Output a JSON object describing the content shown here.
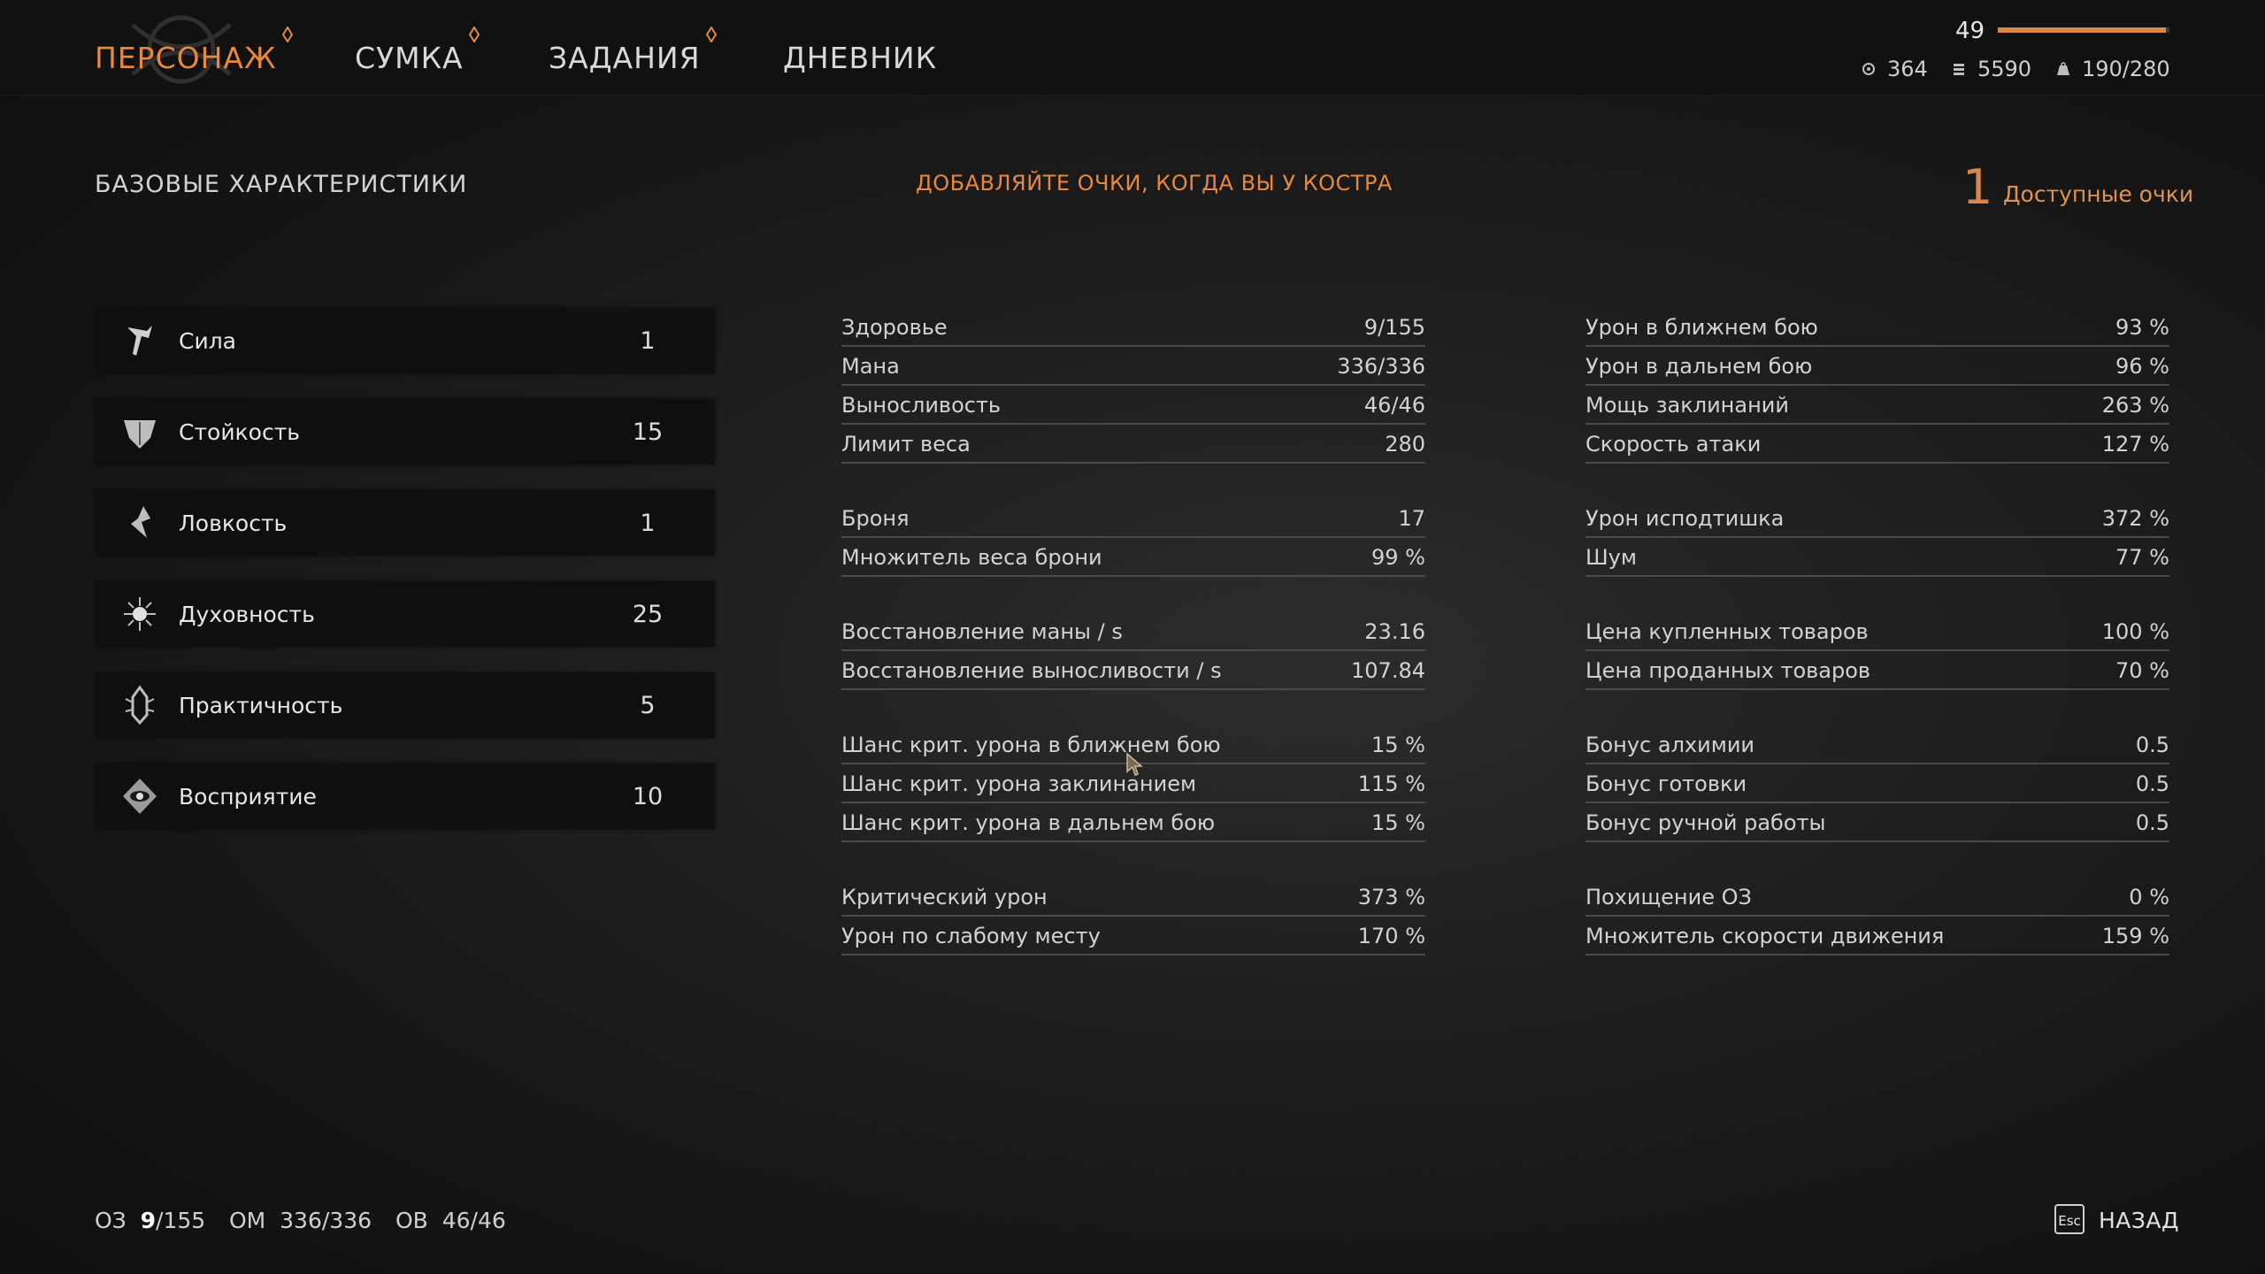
{
  "nav": {
    "tabs": [
      {
        "label": "ПЕРСОНАЖ",
        "active": true
      },
      {
        "label": "СУМКА",
        "active": false
      },
      {
        "label": "ЗАДАНИЯ",
        "active": false
      },
      {
        "label": "ДНЕВНИК",
        "active": false
      }
    ]
  },
  "player": {
    "level": "49",
    "xp_progress": 0.98,
    "resources": {
      "first": {
        "value": "364",
        "icon": "coin-icon"
      },
      "second": {
        "value": "5590",
        "icon": "coins-stack-icon"
      },
      "weight": {
        "value": "190/280",
        "icon": "weight-icon"
      }
    }
  },
  "base": {
    "title": "БАЗОВЫЕ ХАРАКТЕРИСТИКИ",
    "hint": "ДОБАВЛЯЙТЕ ОЧКИ, КОГДА ВЫ У КОСТРА",
    "available_points": "1",
    "available_label": "Доступные очки"
  },
  "attributes": [
    {
      "label": "Сила",
      "value": "1",
      "icon": "strength-icon"
    },
    {
      "label": "Стойкость",
      "value": "15",
      "icon": "endurance-icon"
    },
    {
      "label": "Ловкость",
      "value": "1",
      "icon": "dexterity-icon"
    },
    {
      "label": "Духовность",
      "value": "25",
      "icon": "spirit-icon"
    },
    {
      "label": "Практичность",
      "value": "5",
      "icon": "practicality-icon"
    },
    {
      "label": "Восприятие",
      "value": "10",
      "icon": "perception-icon"
    }
  ],
  "stats_left": [
    {
      "name": "Здоровье",
      "value": "9/155"
    },
    {
      "name": "Мана",
      "value": "336/336"
    },
    {
      "name": "Выносливость",
      "value": "46/46"
    },
    {
      "name": "Лимит веса",
      "value": "280"
    },
    {
      "name": "Броня",
      "value": "17"
    },
    {
      "name": "Множитель веса брони",
      "value": "99 %"
    },
    {
      "name": "Восстановление маны / s",
      "value": "23.16"
    },
    {
      "name": "Восстановление выносливости / s",
      "value": "107.84"
    },
    {
      "name": "Шанс крит. урона в ближнем бою",
      "value": "15 %"
    },
    {
      "name": "Шанс крит. урона заклинанием",
      "value": "115 %"
    },
    {
      "name": "Шанс крит. урона в дальнем бою",
      "value": "15 %"
    },
    {
      "name": "Критический урон",
      "value": "373 %"
    },
    {
      "name": "Урон по слабому месту",
      "value": "170 %"
    }
  ],
  "stats_right": [
    {
      "name": "Урон в ближнем бою",
      "value": "93 %"
    },
    {
      "name": "Урон в дальнем бою",
      "value": "96 %"
    },
    {
      "name": "Мощь заклинаний",
      "value": "263 %"
    },
    {
      "name": "Скорость атаки",
      "value": "127 %"
    },
    {
      "name": "Урон исподтишка",
      "value": "372 %"
    },
    {
      "name": "Шум",
      "value": "77 %"
    },
    {
      "name": "Цена купленных товаров",
      "value": "100 %"
    },
    {
      "name": "Цена проданных товаров",
      "value": "70 %"
    },
    {
      "name": "Бонус алхимии",
      "value": "0.5"
    },
    {
      "name": "Бонус готовки",
      "value": "0.5"
    },
    {
      "name": "Бонус ручной работы",
      "value": "0.5"
    },
    {
      "name": "Похищение ОЗ",
      "value": "0 %"
    },
    {
      "name": "Множитель скорости движения",
      "value": "159 %"
    }
  ],
  "footer": {
    "hp_label": "ОЗ",
    "hp_current": "9",
    "hp_max": "/155",
    "mp_label": "ОМ",
    "mp_value": "336/336",
    "sp_label": "ОВ",
    "sp_value": "46/46",
    "esc_key": "Esc",
    "back_label": "НАЗАД"
  },
  "colors": {
    "accent": "#e7883f",
    "xp_bar": "#d98845"
  }
}
